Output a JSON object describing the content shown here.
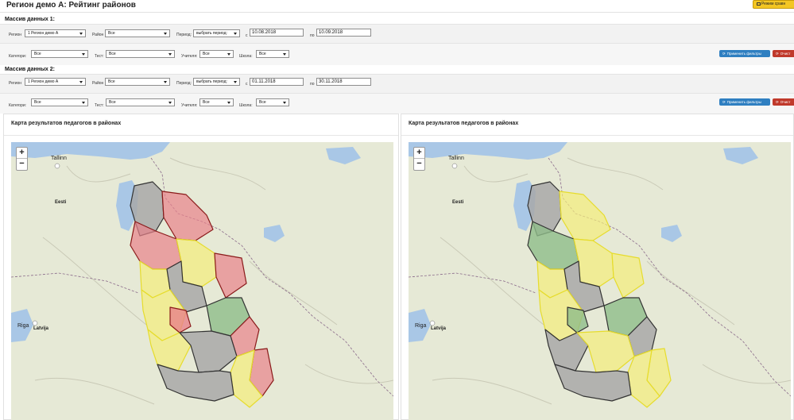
{
  "header": {
    "title": "Регион демо А: Рейтинг районов",
    "mode_button": "Режим сравн"
  },
  "dataset1": {
    "title": "Массив данных 1:",
    "region_label": "Регион",
    "region_value": "1 Регион демо А",
    "district_label": "Район",
    "district_value": "Все",
    "period_label": "Период:",
    "period_value": "выбрать период:",
    "from_label": "с",
    "from_value": "10.08.2018",
    "to_label": "по",
    "to_value": "10.09.2018",
    "category_label": "Категори:",
    "category_value": "Все",
    "test_label": "Тест:",
    "test_value": "Все",
    "teacher_label": "Учителя:",
    "teacher_value": "Все",
    "school_label": "Школа:",
    "school_value": "Все",
    "apply_label": "Применить фильтры",
    "clear_label": "Очист"
  },
  "dataset2": {
    "title": "Массив данных 2:",
    "region_label": "Регион",
    "region_value": "1 Регион демо А",
    "district_label": "Район",
    "district_value": "Все",
    "period_label": "Период:",
    "period_value": "выбрать период:",
    "from_label": "с",
    "from_value": "01.11.2018",
    "to_label": "по",
    "to_value": "30.11.2018",
    "category_label": "Категори:",
    "category_value": "Все",
    "test_label": "Тест:",
    "test_value": "Все",
    "teacher_label": "Учителя:",
    "teacher_value": "Все",
    "school_label": "Школа:",
    "school_value": "Все",
    "apply_label": "Применить фильтры",
    "clear_label": "Очист"
  },
  "panels": [
    {
      "title": "Карта результатов педагогов в районах"
    },
    {
      "title": "Карта результатов педагогов в районах"
    }
  ],
  "map": {
    "zoom_in": "+",
    "zoom_out": "−",
    "labels": {
      "tallinn": "Tallinn",
      "eesti": "Eesti",
      "riga": "Riga",
      "latvija": "Latvija"
    }
  },
  "colors": {
    "red": "#e8828a",
    "yellow": "#f3ec7a",
    "gray": "#a8a8a8",
    "green": "#8fbd8a",
    "apply_button": "#2f7fc1",
    "clear_button": "#c0392b",
    "mode_button": "#f3c623"
  }
}
